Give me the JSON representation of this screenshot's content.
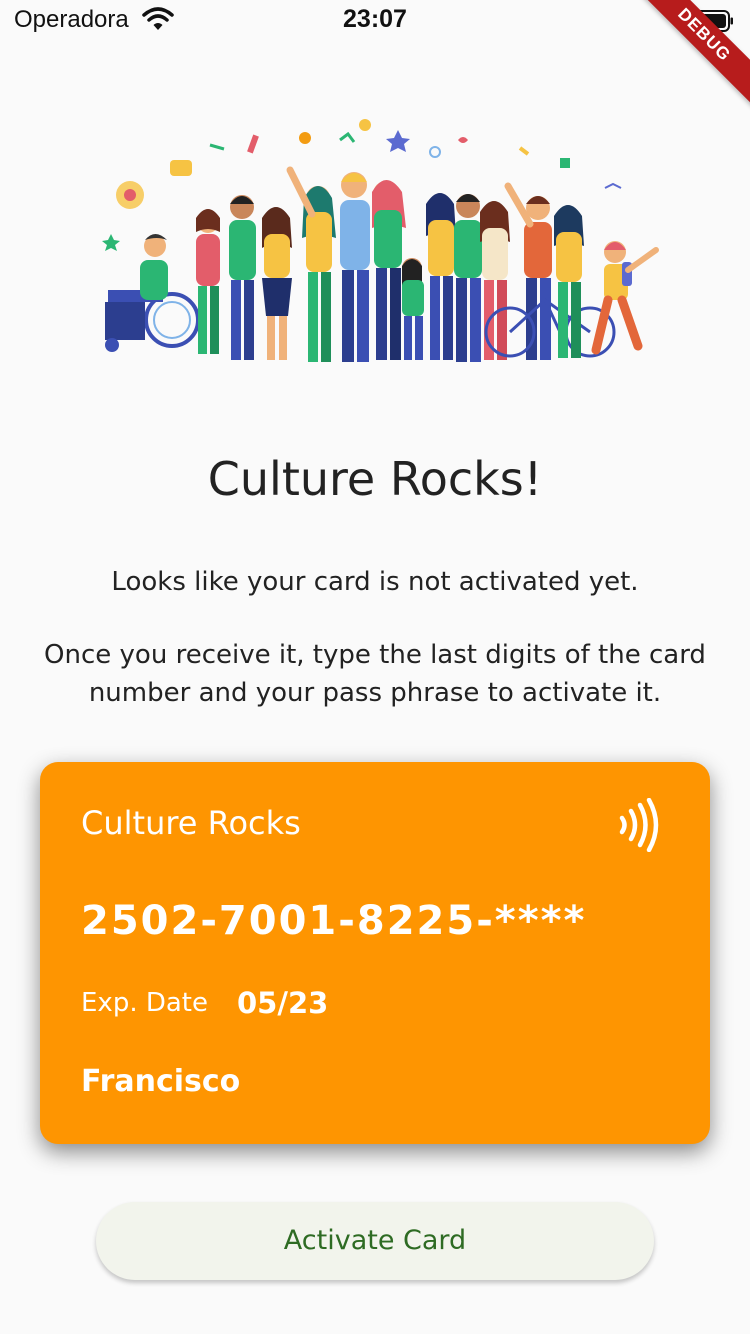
{
  "status_bar": {
    "carrier": "Operadora",
    "time": "23:07",
    "debug_label": "DEBUG",
    "icons": [
      "wifi-icon",
      "battery-icon"
    ]
  },
  "illustration": {
    "description_icon": "people-crowd-illustration"
  },
  "main": {
    "title": "Culture Rocks!",
    "message_line_1": "Looks like your card is not activated yet.",
    "message_line_2": "Once you receive it, type the last digits of the card number and your pass phrase to activate it."
  },
  "card": {
    "brand": "Culture Rocks",
    "number": "2502-7001-8225-****",
    "exp_label": "Exp. Date",
    "exp_value": "05/23",
    "holder": "Francisco",
    "color": "#fe9501",
    "icon": "nfc-icon"
  },
  "actions": {
    "activate_label": "Activate Card",
    "activate_text_color": "#2e6b23"
  }
}
